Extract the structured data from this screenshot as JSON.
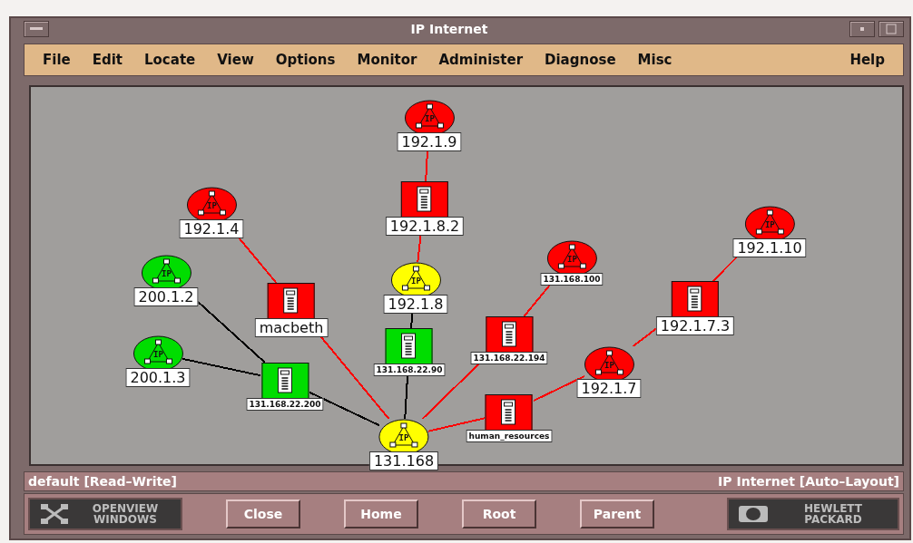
{
  "window": {
    "title": "IP Internet"
  },
  "menu": [
    "File",
    "Edit",
    "Locate",
    "View",
    "Options",
    "Monitor",
    "Administer",
    "Diagnose",
    "Misc",
    "Help"
  ],
  "map": {
    "nodes": [
      {
        "kind": "network",
        "label": "192.1.9",
        "symbol": "IP",
        "color": "#ff0000"
      },
      {
        "kind": "network",
        "label": "192.1.4",
        "symbol": "IP",
        "color": "#ff0000"
      },
      {
        "kind": "computer",
        "label": "192.1.8.2",
        "color": "#ff0000"
      },
      {
        "kind": "network",
        "label": "192.1.10",
        "symbol": "IP",
        "color": "#ff0000"
      },
      {
        "kind": "network",
        "label": "131.168.100",
        "symbol": "IP",
        "color": "#ff0000"
      },
      {
        "kind": "network",
        "label": "200.1.2",
        "symbol": "IP",
        "color": "#00dd00"
      },
      {
        "kind": "network",
        "label": "192.1.8",
        "symbol": "IP",
        "color": "#ffff00"
      },
      {
        "kind": "computer",
        "label": "macbeth",
        "color": "#ff0000"
      },
      {
        "kind": "computer",
        "label": "192.1.7.3",
        "color": "#ff0000"
      },
      {
        "kind": "network",
        "label": "200.1.3",
        "symbol": "IP",
        "color": "#00dd00"
      },
      {
        "kind": "computer",
        "label": "131.168.22.90",
        "color": "#00dd00"
      },
      {
        "kind": "computer",
        "label": "131.168.22.194",
        "color": "#ff0000"
      },
      {
        "kind": "computer",
        "label": "131.168.22.200",
        "color": "#00dd00"
      },
      {
        "kind": "network",
        "label": "192.1.7",
        "symbol": "IP",
        "color": "#ff0000"
      },
      {
        "kind": "network",
        "label": "131.168",
        "symbol": "IP",
        "color": "#ffff00"
      },
      {
        "kind": "computer",
        "label": "human_resources",
        "color": "#ff0000"
      }
    ],
    "links": [
      {
        "color": "#ff0000"
      },
      {
        "color": "#ff0000"
      },
      {
        "color": "#ff0000"
      },
      {
        "color": "#ff0000"
      },
      {
        "color": "#000000"
      },
      {
        "color": "#000000"
      },
      {
        "color": "#000000"
      },
      {
        "color": "#000000"
      },
      {
        "color": "#000000"
      },
      {
        "color": "#ff0000"
      },
      {
        "color": "#ff0000"
      },
      {
        "color": "#ff0000"
      },
      {
        "color": "#ff0000"
      },
      {
        "color": "#ff0000"
      },
      {
        "color": "#ff0000"
      }
    ]
  },
  "status_bar": {
    "left": "default [Read–Write]",
    "right": "IP Internet [Auto–Layout]"
  },
  "logos": [
    {
      "lines": [
        "OPENVIEW",
        "WINDOWS"
      ]
    },
    {
      "lines": [
        "HEWLETT",
        "PACKARD"
      ]
    }
  ],
  "buttons": [
    "Close",
    "Home",
    "Root",
    "Parent"
  ]
}
